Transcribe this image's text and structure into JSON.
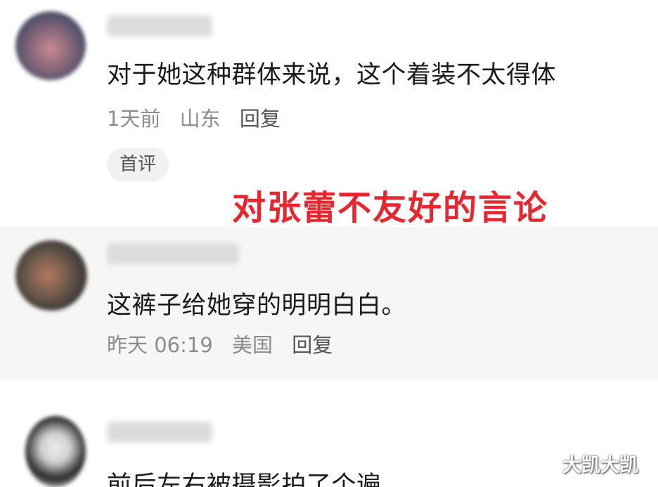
{
  "comments": [
    {
      "username": "",
      "text": "对于她这种群体来说，这个着装不太得体",
      "time": "1天前",
      "location": "山东",
      "reply_label": "回复",
      "badge": "首评"
    },
    {
      "username": "",
      "text": "这裤子给她穿的明明白白。",
      "time": "昨天 06:19",
      "location": "美国",
      "reply_label": "回复"
    },
    {
      "username": "",
      "text": "前后左右被摄影拍了个遍"
    }
  ],
  "overlay": {
    "title": "对张蕾不友好的言论",
    "title_color": "#e8262f"
  },
  "watermark": "大凯大凯"
}
